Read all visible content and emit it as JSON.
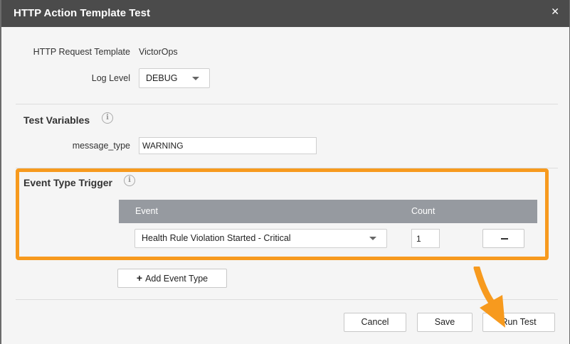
{
  "dialog": {
    "title": "HTTP Action Template Test",
    "close_icon": "close-icon"
  },
  "request": {
    "template_label": "HTTP Request Template",
    "template_value": "VictorOps",
    "log_level_label": "Log Level",
    "log_level_value": "DEBUG"
  },
  "test_variables": {
    "title": "Test Variables",
    "var_label": "message_type",
    "var_value": "WARNING"
  },
  "event_trigger": {
    "title": "Event Type Trigger",
    "columns": {
      "event": "Event",
      "count": "Count"
    },
    "row": {
      "event": "Health Rule Violation Started - Critical",
      "count": "1"
    },
    "add_label": "Add Event Type"
  },
  "footer": {
    "cancel": "Cancel",
    "save": "Save",
    "run": "Run Test"
  },
  "colors": {
    "highlight": "#f79a1e",
    "titlebar": "#4b4b4b",
    "table_header": "#969aa0"
  }
}
